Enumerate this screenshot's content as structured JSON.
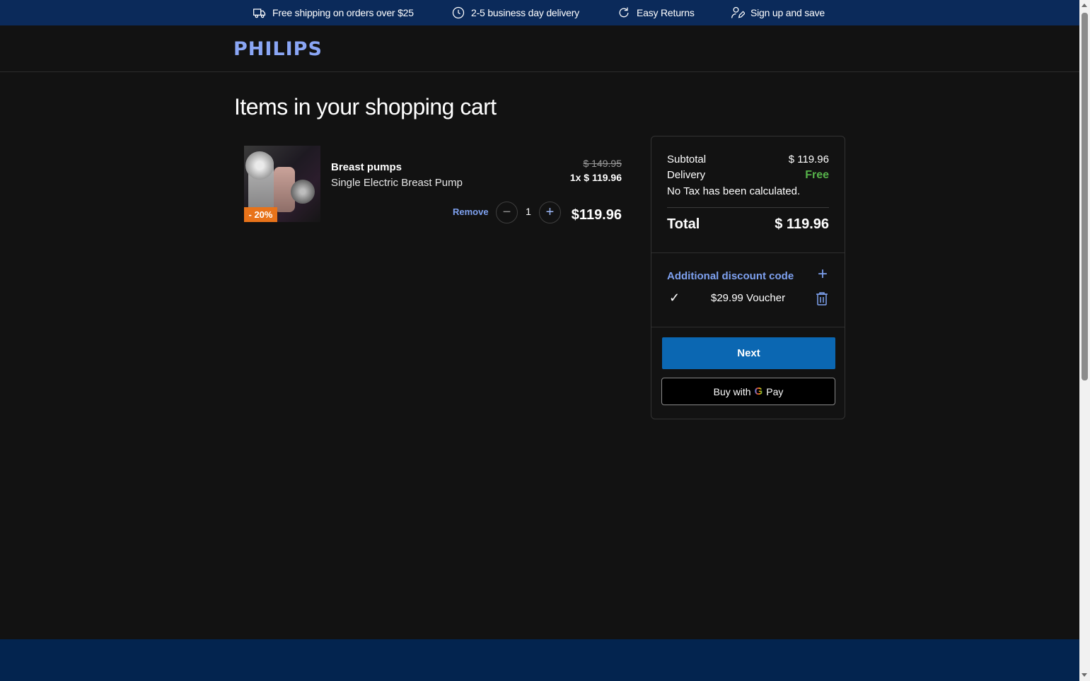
{
  "promo": {
    "shipping": "Free shipping on orders over $25",
    "delivery": "2-5 business day delivery",
    "returns": "Easy Returns",
    "signup": "Sign up and save"
  },
  "header": {
    "logo": "PHILIPS"
  },
  "page": {
    "title": "Items in your shopping cart"
  },
  "cart_item": {
    "category": "Breast pumps",
    "name": "Single Electric Breast Pump",
    "discount_badge": "- 20%",
    "old_price": "$ 149.95",
    "unit_price": "1x $ 119.96",
    "remove_label": "Remove",
    "quantity": "1",
    "line_total": "$119.96",
    "minus_symbol": "−",
    "plus_symbol": "+"
  },
  "summary": {
    "subtotal_label": "Subtotal",
    "subtotal_value": "$ 119.96",
    "delivery_label": "Delivery",
    "delivery_value": "Free",
    "tax_note": "No Tax has been calculated.",
    "total_label": "Total",
    "total_value": "$ 119.96",
    "discount_title": "Additional discount code",
    "discount_plus": "+",
    "voucher_check": "✓",
    "voucher_label": "$29.99 Voucher",
    "next_label": "Next",
    "gpay_prefix": "Buy with",
    "gpay_g": "G",
    "gpay_pay": "Pay"
  },
  "colors": {
    "promo_bar": "#0b2a5a",
    "accent_link": "#7ea1f0",
    "primary_button": "#0b67b2",
    "free_green": "#56b24a",
    "badge_orange": "#e8731a",
    "footer": "#03244f"
  }
}
